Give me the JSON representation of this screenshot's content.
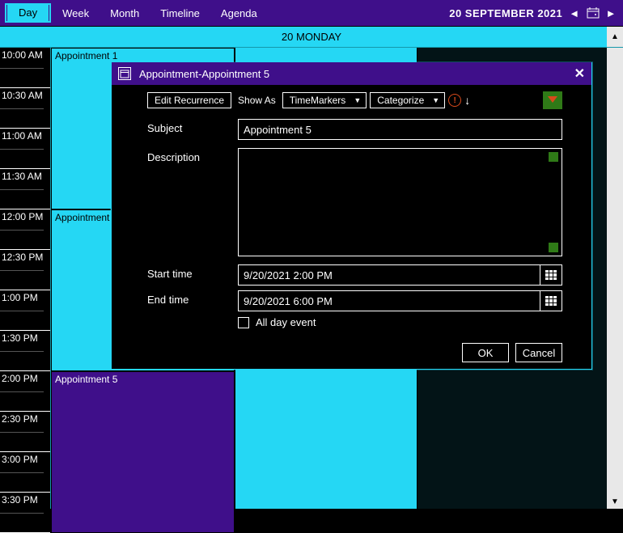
{
  "toolbar": {
    "views": [
      {
        "label": "Day",
        "selected": true
      },
      {
        "label": "Week",
        "selected": false
      },
      {
        "label": "Month",
        "selected": false
      },
      {
        "label": "Timeline",
        "selected": false
      },
      {
        "label": "Agenda",
        "selected": false
      }
    ],
    "current_date": "20 SEPTEMBER 2021"
  },
  "day_header": "20 MONDAY",
  "time_slots": [
    "10:00 AM",
    "10:30 AM",
    "11:00 AM",
    "11:30 AM",
    "12:00 PM",
    "12:30 PM",
    "1:00 PM",
    "1:30 PM",
    "2:00 PM",
    "2:30 PM",
    "3:00 PM",
    "3:30 PM"
  ],
  "appointments": [
    {
      "title": "Appointment 1"
    },
    {
      "title": "Appointment"
    },
    {
      "title": "Appointment 5"
    }
  ],
  "dialog": {
    "title": "Appointment-Appointment 5",
    "toolbar": {
      "edit_recurrence": "Edit Recurrence",
      "show_as": "Show As",
      "time_markers": "TimeMarkers",
      "categorize": "Categorize"
    },
    "labels": {
      "subject": "Subject",
      "description": "Description",
      "start_time": "Start time",
      "end_time": "End time",
      "all_day": "All day event"
    },
    "values": {
      "subject": "Appointment 5",
      "start_time": "9/20/2021 2:00 PM",
      "end_time": "9/20/2021 6:00 PM"
    },
    "buttons": {
      "ok": "OK",
      "cancel": "Cancel"
    }
  }
}
